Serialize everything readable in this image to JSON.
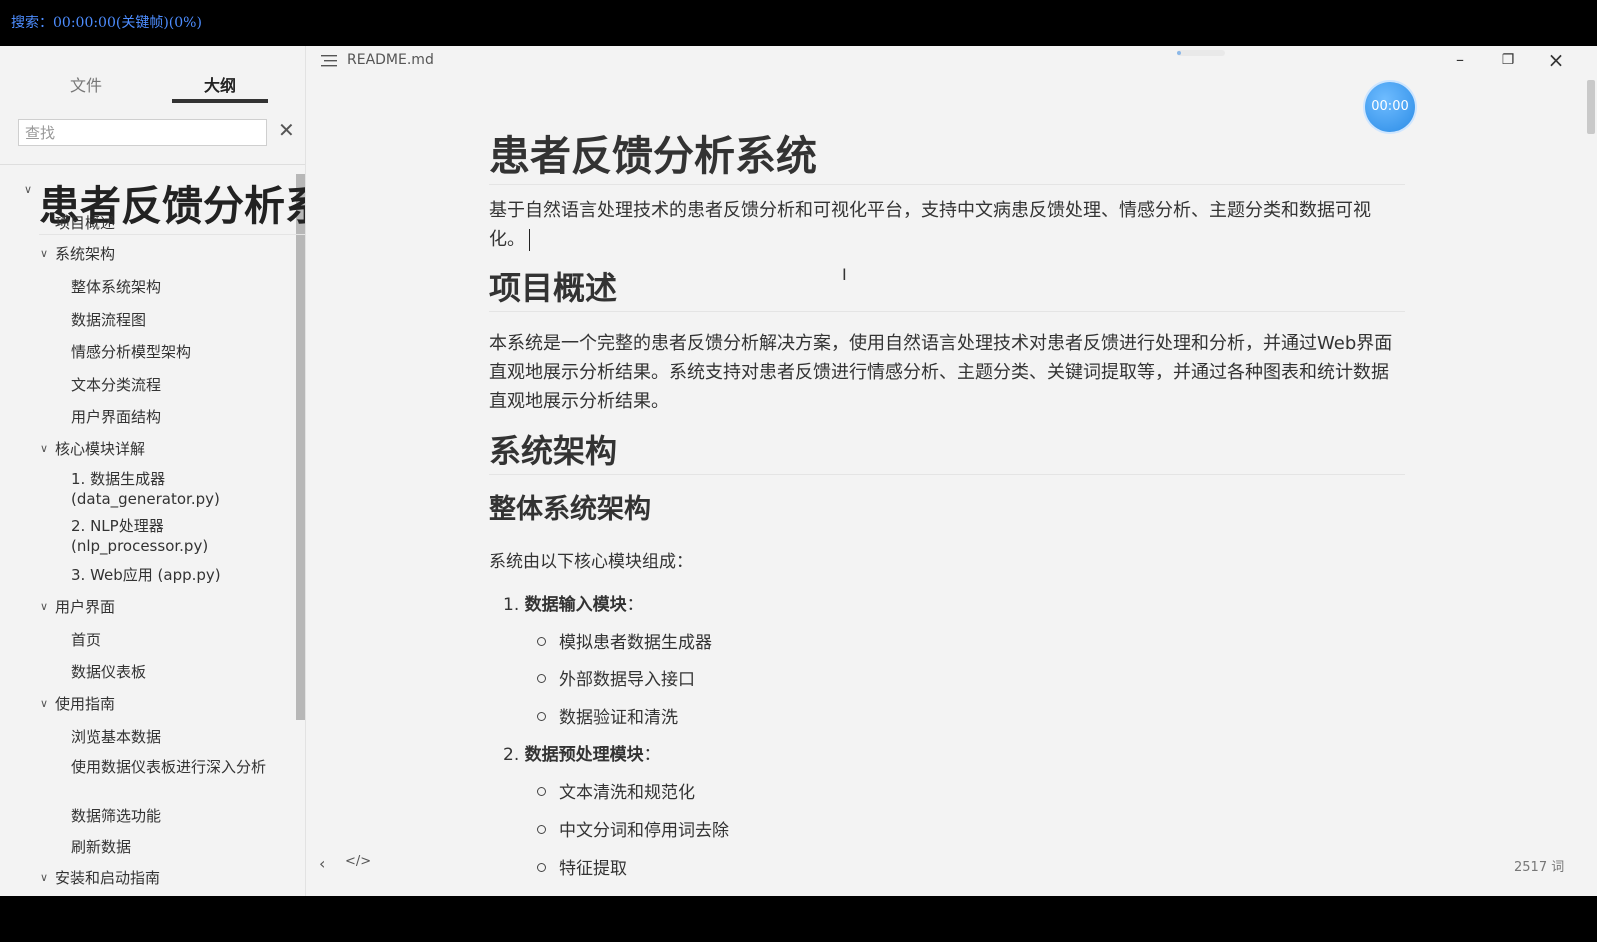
{
  "top_bar": {
    "search_status": "搜索：00:00:00(关键帧)(0%)"
  },
  "sidebar": {
    "tab_files": "文件",
    "tab_outline": "大纲",
    "search_placeholder": "查找",
    "search_clear": "✕",
    "outline": [
      "患者反馈分析系统",
      "项目概述",
      "系统架构",
      "整体系统架构",
      "数据流程图",
      "情感分析模型架构",
      "文本分类流程",
      "用户界面结构",
      "核心模块详解",
      "1. 数据生成器 (data_generator.py)",
      "2. NLP处理器 (nlp_processor.py)",
      "3. Web应用 (app.py)",
      "用户界面",
      "首页",
      "数据仪表板",
      "使用指南",
      "浏览基本数据",
      "使用数据仪表板进行深入分析",
      "数据筛选功能",
      "刷新数据",
      "安装和启动指南"
    ]
  },
  "editor": {
    "file_title": "README.md",
    "timer": "00:00",
    "word_count": "2517 词",
    "doc": {
      "title": "患者反馈分析系统",
      "intro": "基于自然语言处理技术的患者反馈分析和可视化平台，支持中文病患反馈处理、情感分析、主题分类和数据可视化。",
      "h_overview": "项目概述",
      "overview_text": "本系统是一个完整的患者反馈分析解决方案，使用自然语言处理技术对患者反馈进行处理和分析，并通过Web界面直观地展示分析结果。系统支持对患者反馈进行情感分析、主题分类、关键词提取等，并通过各种图表和统计数据直观地展示分析结果。",
      "h_arch": "系统架构",
      "h_overall": "整体系统架构",
      "modules_intro": "系统由以下核心模块组成：",
      "item1_num": "1.",
      "item1_title": "数据输入模块",
      "item1_sub": [
        "模拟患者数据生成器",
        "外部数据导入接口",
        "数据验证和清洗"
      ],
      "item2_num": "2.",
      "item2_title": "数据预处理模块",
      "item2_sub": [
        "文本清洗和规范化",
        "中文分词和停用词去除",
        "特征提取"
      ],
      "colon": "："
    }
  },
  "icons": {
    "menu": "menu-icon",
    "minimize": "minimize-icon",
    "restore": "restore-icon",
    "close": "close-icon",
    "back": "chevron-left-icon",
    "source": "code-icon"
  }
}
